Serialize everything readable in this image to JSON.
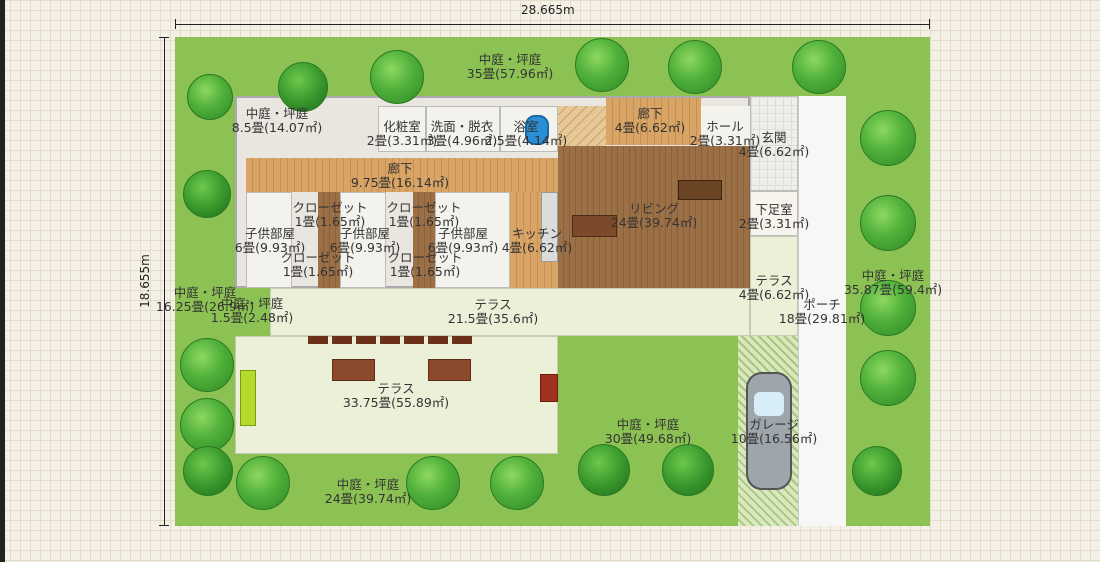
{
  "dimensions": {
    "width_label": "28.665m",
    "height_label": "18.655m"
  },
  "rooms": {
    "garden_top": "中庭・坪庭\n35畳(57.96㎡)",
    "garden_topleft": "中庭・坪庭\n8.5畳(14.07㎡)",
    "powder": "化粧室\n2畳(3.31㎡)",
    "washroom": "洗面・脱衣\n3畳(4.96㎡)",
    "bath": "浴室\n2.5畳(4.14㎡)",
    "corridor_top": "廊下\n4畳(6.62㎡)",
    "hall": "ホール\n2畳(3.31㎡)",
    "entrance": "玄関\n4畳(6.62㎡)",
    "corridor_main": "廊下\n9.75畳(16.14㎡)",
    "closet1": "クローゼット\n1畳(1.65㎡)",
    "closet2": "クローゼット\n1畳(1.65㎡)",
    "kids1": "子供部屋\n6畳(9.93㎡)",
    "kids2": "子供部屋\n6畳(9.93㎡)",
    "kids3": "子供部屋\n6畳(9.93㎡)",
    "kitchen": "キッチン\n4畳(6.62㎡)",
    "living": "リビング\n24畳(39.74㎡)",
    "shoe": "下足室\n2畳(3.31㎡)",
    "closet3": "クローゼット\n1畳(1.65㎡)",
    "closet4": "クローゼット\n1畳(1.65㎡)",
    "terrace_small": "テラス\n4畳(6.62㎡)",
    "garden_left": "中庭・坪庭\n16.25畳(26.9㎡)",
    "garden_tiny": "中庭・坪庭\n1.5畳(2.48㎡)",
    "terrace_mid": "テラス\n21.5畳(35.6㎡)",
    "porch": "ポーチ\n18畳(29.81㎡)",
    "garden_right": "中庭・坪庭\n35.87畳(59.4㎡)",
    "terrace_big": "テラス\n33.75畳(55.89㎡)",
    "garden_mid": "中庭・坪庭\n30畳(49.68㎡)",
    "garage": "ガレージ\n10畳(16.56㎡)",
    "garden_bottom": "中庭・坪庭\n24畳(39.74㎡)"
  },
  "colors": {
    "grass": "#8cc253",
    "wood": "#d8a566",
    "terrace": "#edf0d9"
  }
}
